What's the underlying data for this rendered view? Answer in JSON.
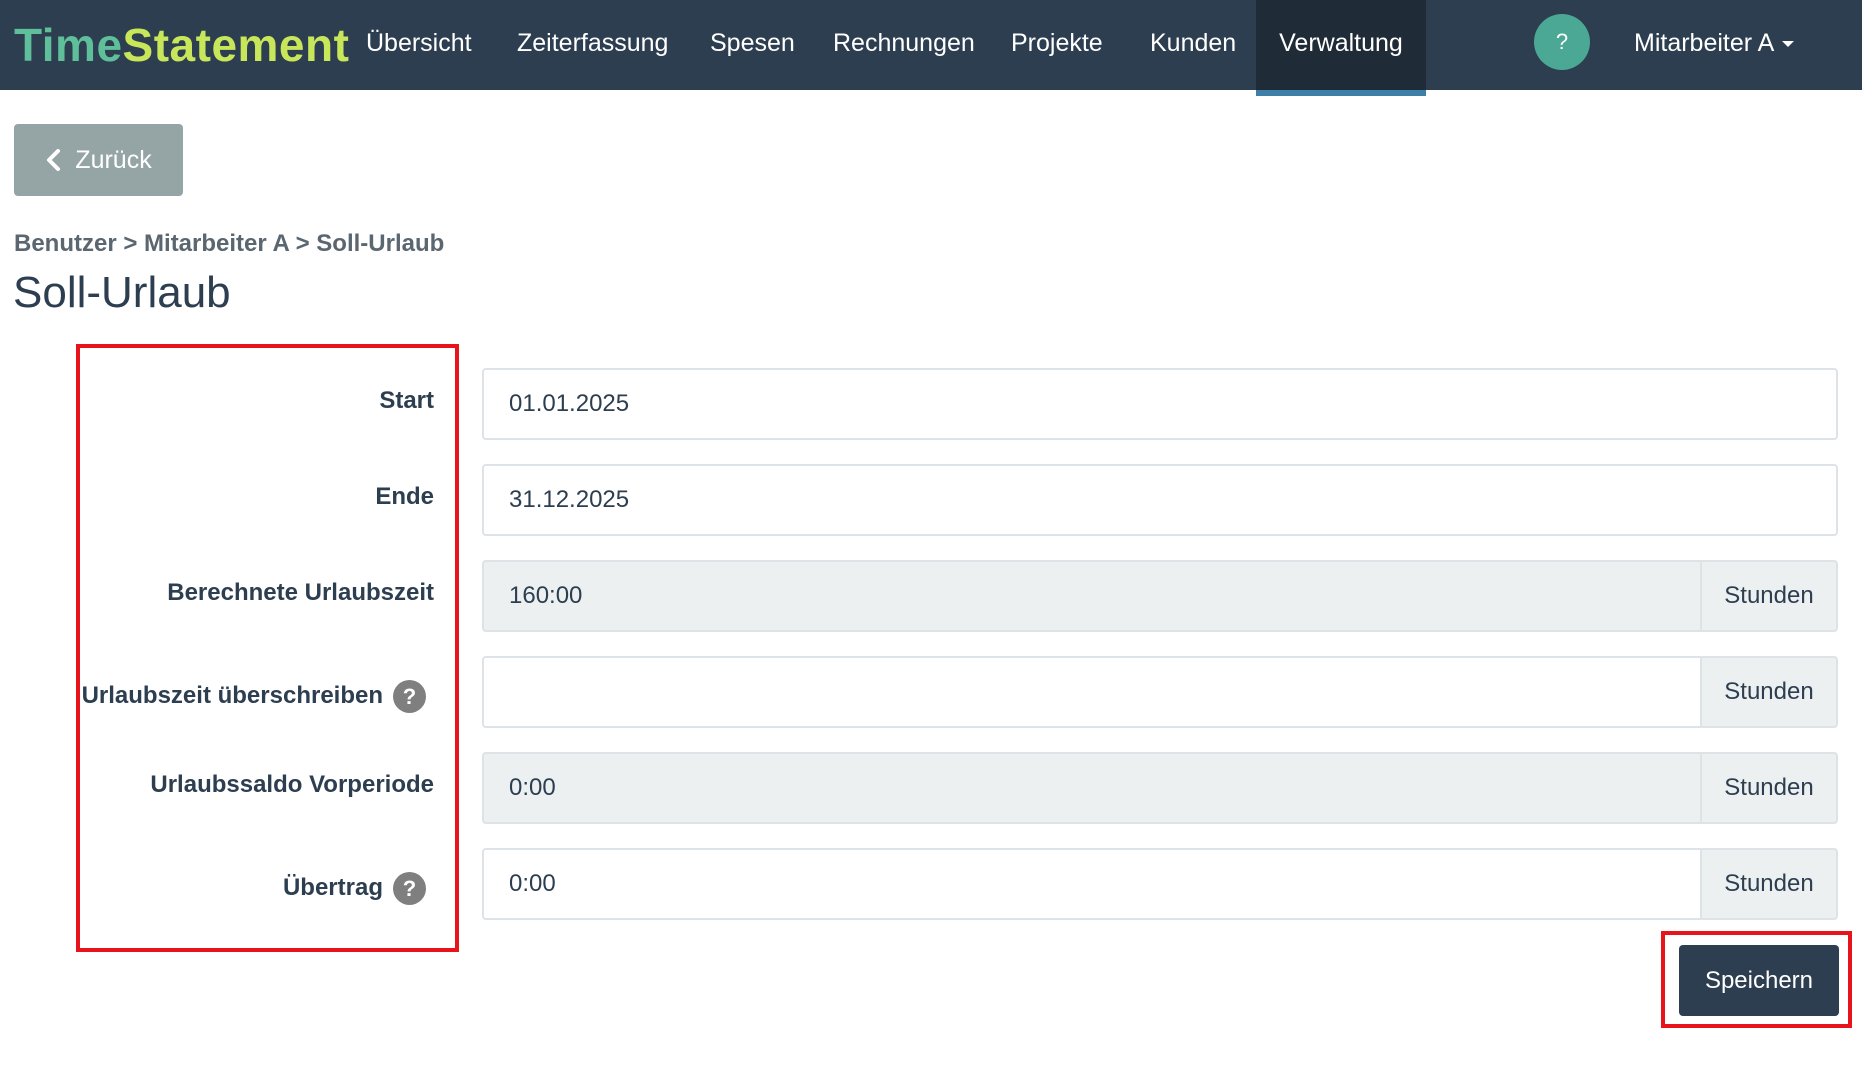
{
  "brand": {
    "part1": "Time",
    "part2": "Statement"
  },
  "nav": {
    "items": [
      {
        "label": "Übersicht"
      },
      {
        "label": "Zeiterfassung"
      },
      {
        "label": "Spesen"
      },
      {
        "label": "Rechnungen"
      },
      {
        "label": "Projekte"
      },
      {
        "label": "Kunden"
      },
      {
        "label": "Verwaltung",
        "active": true
      }
    ],
    "help_label": "?",
    "user_label": "Mitarbeiter A"
  },
  "back_button": {
    "label": "Zurück",
    "icon": "chevron-left-icon"
  },
  "breadcrumb": "Benutzer > Mitarbeiter A > Soll-Urlaub",
  "page_title": "Soll-Urlaub",
  "form": {
    "start": {
      "label": "Start",
      "value": "01.01.2025"
    },
    "end": {
      "label": "Ende",
      "value": "31.12.2025"
    },
    "calculated": {
      "label": "Berechnete Urlaubszeit",
      "value": "160:00",
      "unit": "Stunden"
    },
    "override": {
      "label": "Urlaubszeit überschreiben",
      "help": "?",
      "value": "",
      "unit": "Stunden"
    },
    "previous_balance": {
      "label": "Urlaubssaldo Vorperiode",
      "value": "0:00",
      "unit": "Stunden"
    },
    "carryover": {
      "label": "Übertrag",
      "help": "?",
      "value": "0:00",
      "unit": "Stunden"
    }
  },
  "save_button": {
    "label": "Speichern"
  },
  "colors": {
    "navbar": "#2c3e50",
    "brand_time": "#5fbf9b",
    "brand_statement": "#c8e65a",
    "highlight": "#e8141b",
    "back_button": "#95a5a6"
  }
}
